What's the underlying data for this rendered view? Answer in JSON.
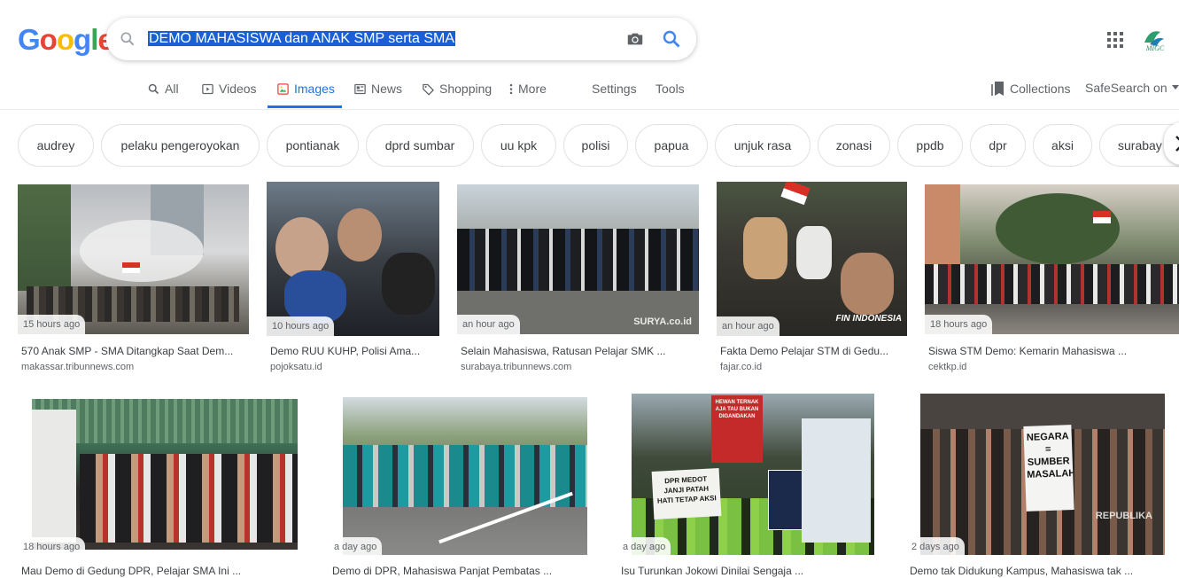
{
  "search": {
    "query": "DEMO MAHASISWA dan ANAK SMP serta SMA"
  },
  "nav": {
    "all": "All",
    "videos": "Videos",
    "images": "Images",
    "news": "News",
    "shopping": "Shopping",
    "more": "More",
    "settings": "Settings",
    "tools": "Tools",
    "collections": "Collections",
    "safesearch": "SafeSearch on"
  },
  "avatar_text": "MIGC",
  "chips": [
    "audrey",
    "pelaku pengeroyokan",
    "pontianak",
    "dprd sumbar",
    "uu kpk",
    "polisi",
    "papua",
    "unjuk rasa",
    "zonasi",
    "ppdb",
    "dpr",
    "aksi",
    "surabay"
  ],
  "results": [
    {
      "time": "15 hours ago",
      "title": "570 Anak SMP - SMA Ditangkap Saat Dem...",
      "source": "makassar.tribunnews.com"
    },
    {
      "time": "10 hours ago",
      "title": "Demo RUU KUHP, Polisi Ama...",
      "source": "pojoksatu.id"
    },
    {
      "time": "an hour ago",
      "title": "Selain Mahasiswa, Ratusan Pelajar SMK ...",
      "source": "surabaya.tribunnews.com",
      "watermark": "SURYA.co.id"
    },
    {
      "time": "an hour ago",
      "title": "Fakta Demo Pelajar STM di Gedu...",
      "source": "fajar.co.id",
      "watermark": "FIN INDONESIA"
    },
    {
      "time": "18 hours ago",
      "title": "Siswa STM Demo: Kemarin Mahasiswa ...",
      "source": "cektkp.id"
    },
    {
      "time": "18 hours ago",
      "title": "Mau Demo di Gedung DPR, Pelajar SMA Ini ..."
    },
    {
      "time": "a day ago",
      "title": "Demo di DPR, Mahasiswa Panjat Pembatas ..."
    },
    {
      "time": "a day ago",
      "title": "Isu Turunkan Jokowi Dinilai Sengaja ...",
      "signs": [
        "DPR MEDOT JANJI PATAH HATI TETAP AKSI",
        "HEWAN TERNAK AJA TAU BUKAN DIGANDAKAN"
      ]
    },
    {
      "time": "2 days ago",
      "title": "Demo tak Didukung Kampus, Mahasiswa tak ...",
      "sign": "NEGARA = SUMBER MASALAH",
      "watermark": "REPUBLIKA"
    }
  ]
}
